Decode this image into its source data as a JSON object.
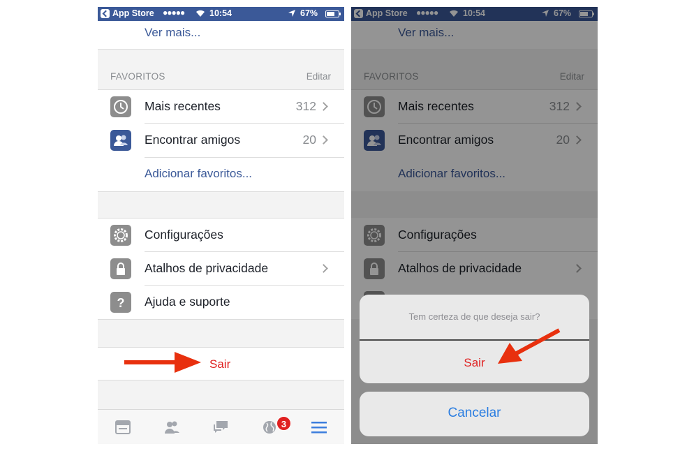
{
  "status_bar": {
    "back_app": "App Store",
    "signal": "●●●●●",
    "time": "10:54",
    "battery": "67%"
  },
  "menu": {
    "see_more": "Ver mais...",
    "favorites_header": "FAVORITOS",
    "favorites_edit": "Editar",
    "favorites": [
      {
        "label": "Mais recentes",
        "count": "312",
        "icon": "clock-icon"
      },
      {
        "label": "Encontrar amigos",
        "count": "20",
        "icon": "friends-icon"
      }
    ],
    "add_favorites": "Adicionar favoritos...",
    "settings_items": [
      {
        "label": "Configurações",
        "icon": "gear-icon"
      },
      {
        "label": "Atalhos de privacidade",
        "icon": "lock-icon"
      },
      {
        "label": "Ajuda e suporte",
        "icon": "question-icon"
      }
    ],
    "logout": "Sair"
  },
  "tab_bar": {
    "notifications_badge": "3",
    "tabs": [
      "news-feed-icon",
      "friend-requests-icon",
      "messages-icon",
      "notifications-globe-icon",
      "menu-hamburger-icon"
    ]
  },
  "dialog": {
    "message": "Tem certeza de que deseja sair?",
    "confirm": "Sair",
    "cancel": "Cancelar"
  },
  "colors": {
    "facebook_blue": "#3b5998",
    "destructive_red": "#e02020",
    "ios_blue": "#2a7de1",
    "annotation_arrow": "#e8300e"
  }
}
